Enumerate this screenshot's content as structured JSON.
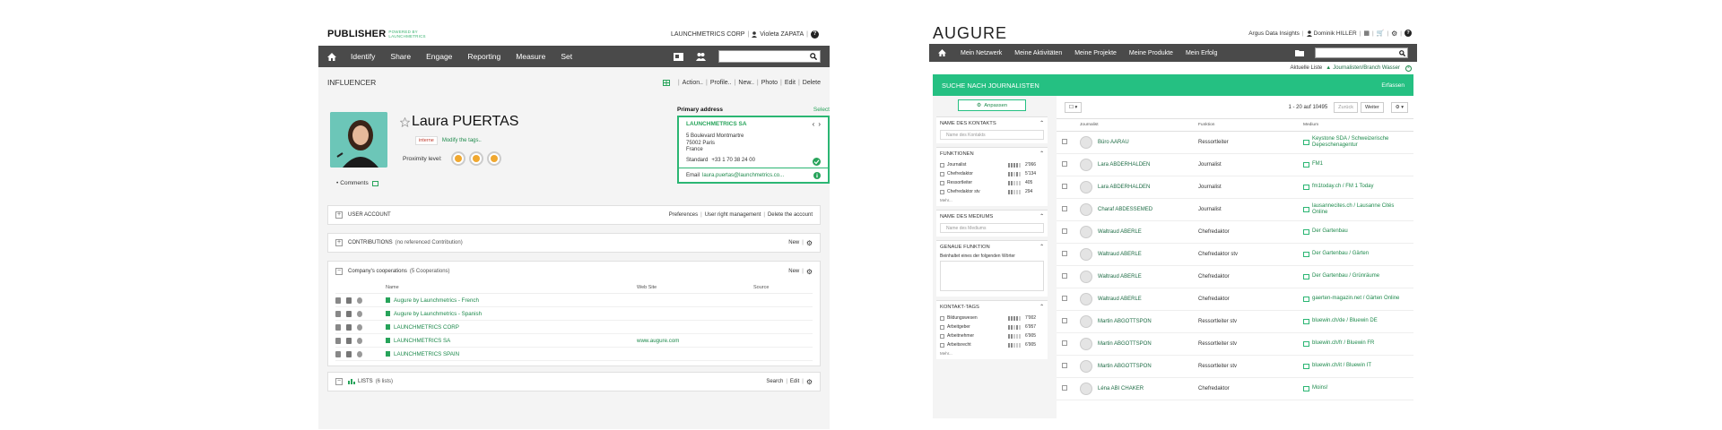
{
  "publisher": {
    "logo": "PUBLISHER",
    "logo_sub": "POWERED BY LAUNCHMETRICS",
    "company": "LAUNCHMETRICS CORP",
    "user": "Violeta ZAPATA",
    "help": "?",
    "nav": [
      "Identify",
      "Share",
      "Engage",
      "Reporting",
      "Measure",
      "Set"
    ],
    "page_title": "INFLUENCER",
    "actions": [
      "Action..",
      "Profile..",
      "New..",
      "Photo",
      "Edit",
      "Delete"
    ],
    "profile": {
      "name": "Laura PUERTAS",
      "badge": "interne",
      "modify_tags": "Modify the tags..",
      "proximity_label": "Proximity level:",
      "comments": "Comments"
    },
    "address": {
      "heading": "Primary address",
      "select": "Select",
      "company": "LAUNCHMETRICS SA",
      "lines": [
        "5 Boulevard Montmartre",
        "75002 Paris",
        "France"
      ],
      "phone_label": "Standard",
      "phone": "+33 1 70 38 24 00",
      "email_label": "Email",
      "email": "laura.puertas@launchmetrics.co..."
    },
    "sections": {
      "user_account": "USER ACCOUNT",
      "ua_links": [
        "Preferences",
        "User right management",
        "Delete the account"
      ],
      "contributions": "CONTRIBUTIONS",
      "contributions_sub": "(no referenced Contribution)",
      "new": "New",
      "coop_title": "Company's cooperations",
      "coop_sub": "(5 Cooperations)",
      "col_name": "Name",
      "col_web": "Web Site",
      "col_source": "Source",
      "lists": "LISTS",
      "lists_sub": "(6 lists)",
      "search": "Search",
      "edit": "Edit"
    },
    "coops": [
      {
        "name": "Augure by Launchmetrics - French",
        "web": ""
      },
      {
        "name": "Augure by Launchmetrics - Spanish",
        "web": ""
      },
      {
        "name": "LAUNCHMETRICS CORP",
        "web": ""
      },
      {
        "name": "LAUNCHMETRICS SA",
        "web": "www.augure.com"
      },
      {
        "name": "LAUNCHMETRICS SPAIN",
        "web": ""
      }
    ]
  },
  "augure": {
    "logo": "AUGURE",
    "org": "Argus Data Insights",
    "user": "Dominik HILLER",
    "nav": [
      "Mein Netzwerk",
      "Meine Aktivitäten",
      "Meine Projekte",
      "Meine Produkte",
      "Mein Erfolg"
    ],
    "current_list_label": "Aktuelle Liste",
    "current_list": "Journalisten/Branch Wasser",
    "search_title": "SUCHE NACH JOURNALISTEN",
    "search_link": "Erfassen",
    "adjust": "Anpassen",
    "filters": {
      "contact_name": "NAME DES KONTAKTS",
      "contact_name_ph": "Name des Kontakts",
      "functions": "FUNKTIONEN",
      "function_items": [
        {
          "label": "Journalist",
          "count": "2'066"
        },
        {
          "label": "Chefredaktor",
          "count": "5'134"
        },
        {
          "label": "Ressortleiter",
          "count": "405"
        },
        {
          "label": "Chefredaktor stv",
          "count": "294"
        }
      ],
      "more": "Mehr...",
      "medium_name": "NAME DES MEDIUMS",
      "medium_name_ph": "Name des Mediums",
      "exact_function": "GENAUE FUNKTION",
      "exact_function_text": "Beinhaltet eines der folgenden Wörter",
      "contact_tags": "KONTAKT-TAGS",
      "tag_items": [
        {
          "label": "Bildungswesen",
          "count": "7'002"
        },
        {
          "label": "Arbeitgeber",
          "count": "6'957"
        },
        {
          "label": "Arbeitnehmer",
          "count": "6'905"
        },
        {
          "label": "Arbeitsrecht",
          "count": "6'905"
        }
      ],
      "more2": "Mehr..."
    },
    "table": {
      "range": "1 - 20 auf 10495",
      "prev": "Zurück",
      "next": "Weiter",
      "headers": [
        "Journalist",
        "Funktion",
        "Medium"
      ],
      "rows": [
        {
          "name": "Büro AARAU",
          "func": "Ressortleiter",
          "medium": "Keystone SDA / Schweizerische Depeschenagentur"
        },
        {
          "name": "Lara ABDERHALDEN",
          "func": "Journalist",
          "medium": "FM1"
        },
        {
          "name": "Lara ABDERHALDEN",
          "func": "Journalist",
          "medium": "fm1today.ch / FM 1 Today"
        },
        {
          "name": "Charaf ABDESSEMED",
          "func": "Journalist",
          "medium": "lausannecites.ch / Lausanne Cités Online"
        },
        {
          "name": "Waltraud ABERLE",
          "func": "Chefredaktor",
          "medium": "Der Gartenbau"
        },
        {
          "name": "Waltraud ABERLE",
          "func": "Chefredaktor stv",
          "medium": "Der Gartenbau / Gärten"
        },
        {
          "name": "Waltraud ABERLE",
          "func": "Chefredaktor",
          "medium": "Der Gartenbau / Grünräume"
        },
        {
          "name": "Waltraud ABERLE",
          "func": "Chefredaktor",
          "medium": "gaerten-magazin.net / Gärten Online"
        },
        {
          "name": "Martin ABGOTTSPON",
          "func": "Ressortleiter stv",
          "medium": "bluewin.ch/de / Bluewin DE"
        },
        {
          "name": "Martin ABGOTTSPON",
          "func": "Ressortleiter stv",
          "medium": "bluewin.ch/fr / Bluewin FR"
        },
        {
          "name": "Martin ABGOTTSPON",
          "func": "Ressortleiter stv",
          "medium": "bluewin.ch/it / Bluewin IT"
        },
        {
          "name": "Léna ABI CHAKER",
          "func": "Chefredaktor",
          "medium": "Moins!"
        }
      ]
    }
  },
  "colors": {
    "accent_green": "#25c082",
    "nav_dark": "#4a4a4a",
    "link_green": "#1e8a4c"
  }
}
